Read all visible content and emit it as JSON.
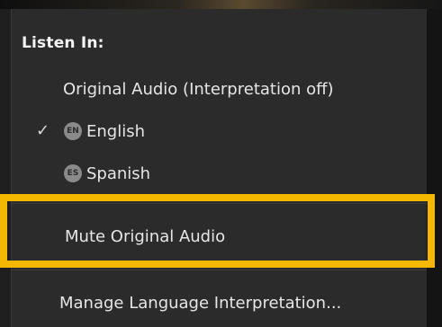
{
  "menu": {
    "heading": "Listen In:",
    "items": [
      {
        "label": "Original Audio (Interpretation off)",
        "checked": false
      },
      {
        "label": "English",
        "badge": "EN",
        "checked": true
      },
      {
        "label": "Spanish",
        "badge": "ES",
        "checked": false
      },
      {
        "label": "Mute Original Audio",
        "highlighted": true
      },
      {
        "label": "Manage Language Interpretation..."
      }
    ],
    "check_glyph": "✓"
  },
  "colors": {
    "menu_background": "#2b2b2b",
    "text": "#e6e6e6",
    "highlight_border": "#f5b800",
    "badge_background": "#8a8a8a"
  },
  "icons": [
    "checkmark-icon",
    "english-badge-icon",
    "spanish-badge-icon"
  ]
}
